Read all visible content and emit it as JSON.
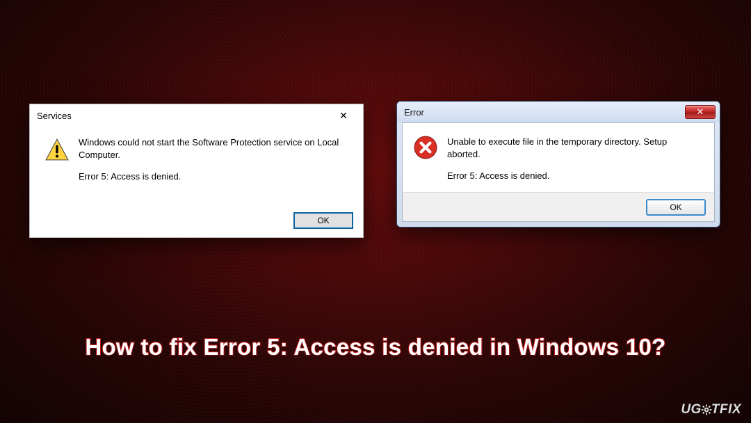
{
  "dialog1": {
    "title": "Services",
    "close_label": "✕",
    "message_line1": "Windows could not start the Software Protection service on Local Computer.",
    "error_line": "Error 5: Access is denied.",
    "ok_label": "OK",
    "icon": "warning-icon"
  },
  "dialog2": {
    "title": "Error",
    "close_label": "✕",
    "message_line1": "Unable to execute file in the temporary directory. Setup aborted.",
    "error_line": "Error 5: Access is denied.",
    "ok_label": "OK",
    "icon": "error-icon"
  },
  "headline": "How to fix Error 5: Access is denied in Windows 10?",
  "watermark": {
    "prefix": "UG",
    "suffix": "TFIX"
  },
  "colors": {
    "accent_red": "#c21818",
    "win10_button_border": "#0a64a4",
    "win7_button_border": "#3b8bd0"
  }
}
